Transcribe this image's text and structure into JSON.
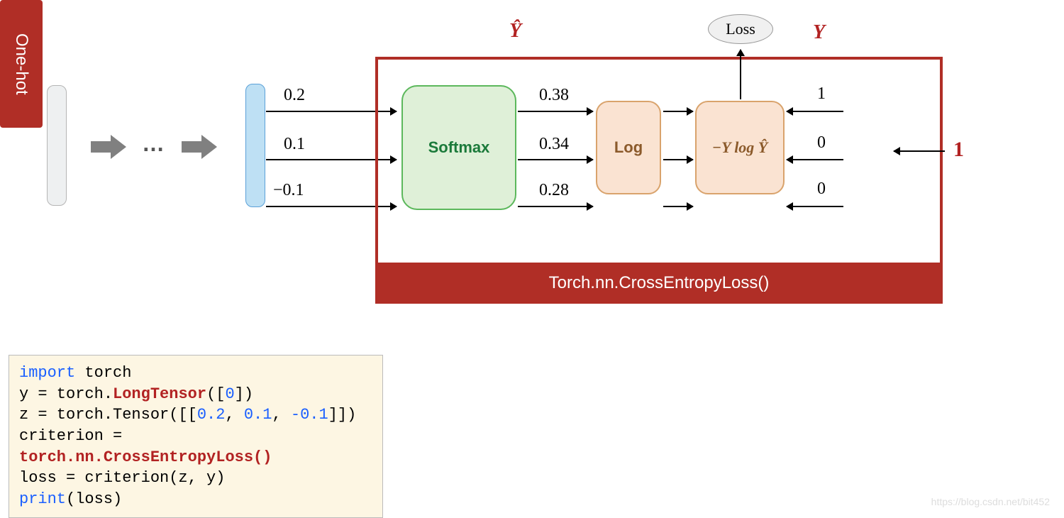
{
  "labels": {
    "yhat": "Ŷ",
    "y": "Y",
    "softmax": "Softmax",
    "log": "Log",
    "nll": "−Y log Ŷ",
    "onehot": "One-hot",
    "loss": "Loss",
    "input_one": "1",
    "caption": "Torch.nn.CrossEntropyLoss()"
  },
  "ellipsis": "…",
  "logits": [
    "0.2",
    "0.1",
    "−0.1"
  ],
  "softmax_out": [
    "0.38",
    "0.34",
    "0.28"
  ],
  "onehot_vec": [
    "1",
    "0",
    "0"
  ],
  "code": {
    "import_kw": "import",
    "torch": " torch",
    "line2a": "y = torch.",
    "longtensor": "LongTensor",
    "line2b": "([",
    "zero": "0",
    "line2c": "])",
    "line3a": "z = torch.Tensor([[",
    "n1": "0.2",
    "c1": ", ",
    "n2": "0.1",
    "c2": ", ",
    "n3": "-0.1",
    "line3b": "]])",
    "line4a": "criterion = ",
    "cel": "torch.nn.CrossEntropyLoss()",
    "line5": "loss = criterion(z, y)",
    "print_kw": "print",
    "line6b": "(loss)"
  },
  "watermark": "https://blog.csdn.net/bit452"
}
